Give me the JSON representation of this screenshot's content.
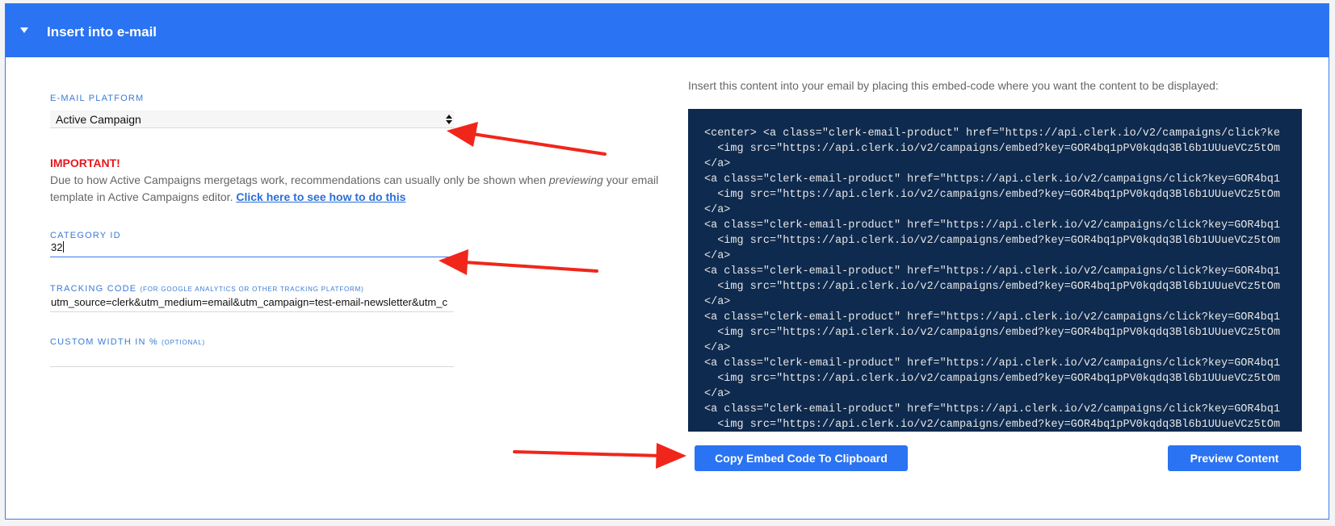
{
  "header": {
    "title": "Insert into e-mail"
  },
  "form": {
    "email_platform_label": "E-MAIL PLATFORM",
    "email_platform_value": "Active Campaign",
    "important_title": "IMPORTANT!",
    "important_text_1": "Due to how Active Campaigns mergetags work, recommendations can usually only be shown when ",
    "important_text_em": "previewing",
    "important_text_2": " your email template in Active Campaigns editor. ",
    "important_link": "Click here to see how to do this",
    "category_id_label": "CATEGORY ID",
    "category_id_value": "32",
    "tracking_code_label": "TRACKING CODE",
    "tracking_code_sublabel": "(FOR GOOGLE ANALYTICS OR OTHER TRACKING PLATFORM)",
    "tracking_code_value": "utm_source=clerk&utm_medium=email&utm_campaign=test-email-newsletter&utm_c",
    "custom_width_label": "CUSTOM WIDTH IN %",
    "custom_width_sublabel": "(OPTIONAL)",
    "custom_width_value": ""
  },
  "embed": {
    "description": "Insert this content into your email by placing this embed-code where you want the content to be displayed:",
    "code_lines": [
      "<center> <a class=\"clerk-email-product\" href=\"https://api.clerk.io/v2/campaigns/click?ke",
      "  <img src=\"https://api.clerk.io/v2/campaigns/embed?key=GOR4bq1pPV0kqdq3Bl6b1UUueVCz5tOm",
      "</a>",
      "<a class=\"clerk-email-product\" href=\"https://api.clerk.io/v2/campaigns/click?key=GOR4bq1",
      "  <img src=\"https://api.clerk.io/v2/campaigns/embed?key=GOR4bq1pPV0kqdq3Bl6b1UUueVCz5tOm",
      "</a>",
      "<a class=\"clerk-email-product\" href=\"https://api.clerk.io/v2/campaigns/click?key=GOR4bq1",
      "  <img src=\"https://api.clerk.io/v2/campaigns/embed?key=GOR4bq1pPV0kqdq3Bl6b1UUueVCz5tOm",
      "</a>",
      "<a class=\"clerk-email-product\" href=\"https://api.clerk.io/v2/campaigns/click?key=GOR4bq1",
      "  <img src=\"https://api.clerk.io/v2/campaigns/embed?key=GOR4bq1pPV0kqdq3Bl6b1UUueVCz5tOm",
      "</a>",
      "<a class=\"clerk-email-product\" href=\"https://api.clerk.io/v2/campaigns/click?key=GOR4bq1",
      "  <img src=\"https://api.clerk.io/v2/campaigns/embed?key=GOR4bq1pPV0kqdq3Bl6b1UUueVCz5tOm",
      "</a>",
      "<a class=\"clerk-email-product\" href=\"https://api.clerk.io/v2/campaigns/click?key=GOR4bq1",
      "  <img src=\"https://api.clerk.io/v2/campaigns/embed?key=GOR4bq1pPV0kqdq3Bl6b1UUueVCz5tOm",
      "</a>",
      "<a class=\"clerk-email-product\" href=\"https://api.clerk.io/v2/campaigns/click?key=GOR4bq1",
      "  <img src=\"https://api.clerk.io/v2/campaigns/embed?key=GOR4bq1pPV0kqdq3Bl6b1UUueVCz5tOm"
    ]
  },
  "buttons": {
    "copy_label": "Copy Embed Code To Clipboard",
    "preview_label": "Preview Content"
  },
  "colors": {
    "header": "#2a73f2",
    "code_background": "#0e2a4e",
    "important": "#e8171c",
    "annotation_arrow": "#f0261b"
  },
  "icons": {
    "header_toggle": "caret-down-icon",
    "select_toggle": "select-arrows-icon",
    "annotation": "red-arrow-icon"
  }
}
